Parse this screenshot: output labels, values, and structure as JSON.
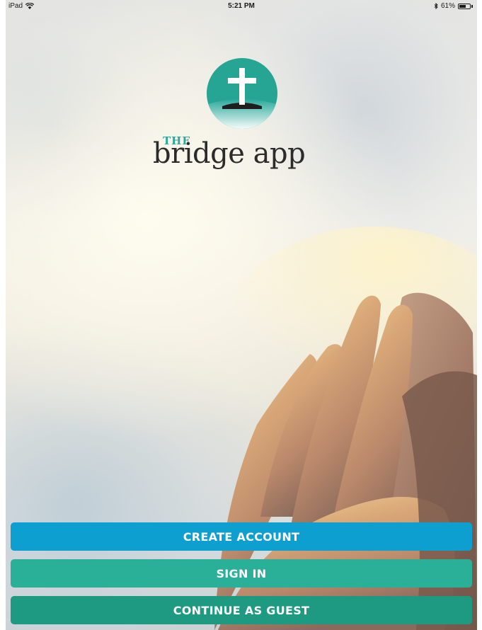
{
  "status_bar": {
    "device": "iPad",
    "time": "5:21 PM",
    "battery": "61%",
    "battery_level": 0.61
  },
  "brand": {
    "prefix": "THE",
    "name": "bridge app",
    "logo_icon": "cross-on-hill-icon",
    "colors": {
      "teal": "#2aa89a",
      "text": "#2b2b2b"
    }
  },
  "actions": {
    "create_account": "CREATE ACCOUNT",
    "sign_in": "SIGN IN",
    "continue_guest": "CONTINUE AS GUEST",
    "colors": {
      "create": "#0d9fd0",
      "sign_in": "#2aaf98",
      "guest": "#1e9a82"
    }
  }
}
